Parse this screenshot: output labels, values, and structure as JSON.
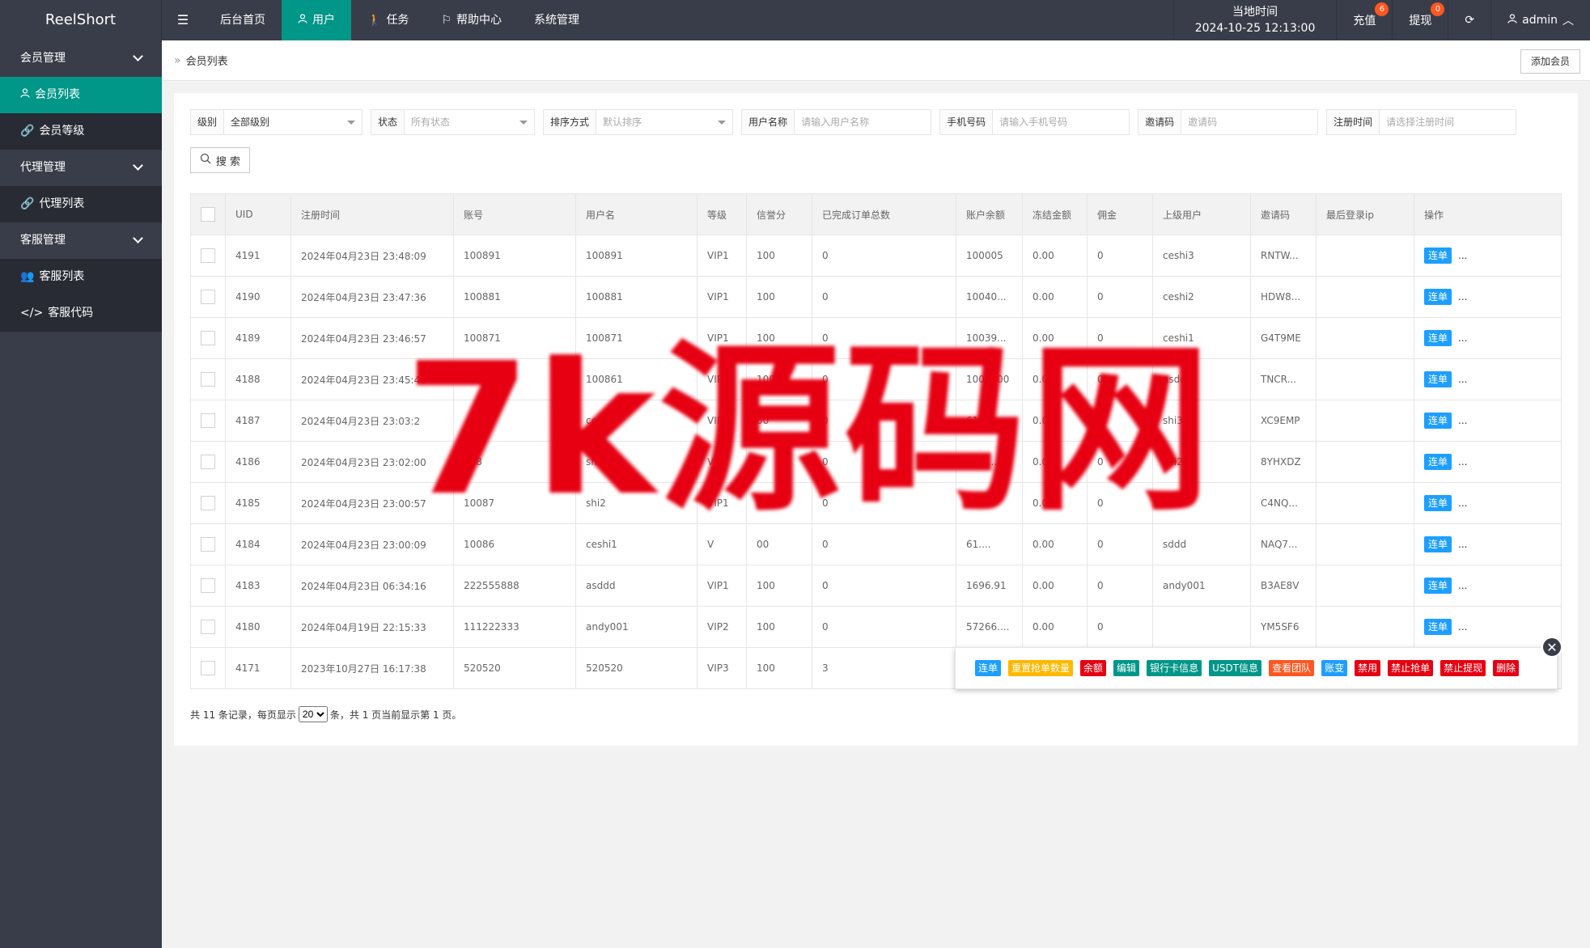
{
  "app": {
    "logo": "ReelShort"
  },
  "topnav": [
    {
      "label": "后台首页",
      "icon": ""
    },
    {
      "label": "用户",
      "icon": "user-icon",
      "active": true
    },
    {
      "label": "任务",
      "icon": "walk-icon"
    },
    {
      "label": "帮助中心",
      "icon": "flag-icon"
    },
    {
      "label": "系统管理",
      "icon": ""
    }
  ],
  "header": {
    "time_label": "当地时间",
    "time_value": "2024-10-25 12:13:00",
    "recharge_label": "充值",
    "recharge_badge": "6",
    "withdraw_label": "提现",
    "withdraw_badge": "0",
    "user": "admin"
  },
  "sidebar": {
    "g1": "会员管理",
    "g1_items": [
      "会员列表",
      "会员等级"
    ],
    "g2": "代理管理",
    "g2_items": [
      "代理列表"
    ],
    "g3": "客服管理",
    "g3_items": [
      "客服列表",
      "客服代码"
    ]
  },
  "breadcrumb": {
    "sep": "»",
    "current": "会员列表"
  },
  "add_button": "添加会员",
  "filters": [
    {
      "label": "级别",
      "value": "全部级别",
      "select": true,
      "dark": true
    },
    {
      "label": "状态",
      "value": "所有状态",
      "select": true
    },
    {
      "label": "排序方式",
      "value": "默认排序",
      "select": true
    },
    {
      "label": "用户名称",
      "value": "请输入用户名称"
    },
    {
      "label": "手机号码",
      "value": "请输入手机号码"
    },
    {
      "label": "邀请码",
      "value": "邀请码"
    },
    {
      "label": "注册时间",
      "value": "请选择注册时间"
    }
  ],
  "search_label": "搜 索",
  "table": {
    "headers": [
      "UID",
      "注册时间",
      "账号",
      "用户名",
      "等级",
      "信誉分",
      "已完成订单总数",
      "账户余额",
      "冻结金额",
      "佣金",
      "上级用户",
      "邀请码",
      "最后登录ip",
      "操作"
    ],
    "rows": [
      [
        "4191",
        "2024年04月23日 23:48:09",
        "100891",
        "100891",
        "VIP1",
        "100",
        "0",
        "100005",
        "0.00",
        "0",
        "ceshi3",
        "RNTW...",
        ""
      ],
      [
        "4190",
        "2024年04月23日 23:47:36",
        "100881",
        "100881",
        "VIP1",
        "100",
        "0",
        "10040...",
        "0.00",
        "0",
        "ceshi2",
        "HDW8...",
        ""
      ],
      [
        "4189",
        "2024年04月23日 23:46:57",
        "100871",
        "100871",
        "VIP1",
        "100",
        "0",
        "10039...",
        "0.00",
        "0",
        "ceshi1",
        "G4T9ME",
        ""
      ],
      [
        "4188",
        "2024年04月23日 23:45:46",
        "100861",
        "100861",
        "VIP2",
        "100",
        "0",
        "1000000",
        "0.00",
        "0",
        "asddd",
        "TNCR...",
        ""
      ],
      [
        "4187",
        "2024年04月23日 23:03:2",
        "",
        "ceshi4",
        "VIP1",
        "00",
        "0",
        "616....",
        "0.00",
        "0",
        "shi3",
        "XC9EMP",
        ""
      ],
      [
        "4186",
        "2024年04月23日 23:02:00",
        "088",
        "shi3",
        "VI",
        "",
        "0",
        "571....",
        "0.00",
        "0",
        "shi2",
        "8YHXDZ",
        ""
      ],
      [
        "4185",
        "2024年04月23日 23:00:57",
        "10087",
        "shi2",
        "VIP1",
        "00",
        "0",
        "34....",
        "0.00",
        "0",
        "shi1",
        "C4NQ...",
        ""
      ],
      [
        "4184",
        "2024年04月23日 23:00:09",
        "10086",
        "ceshi1",
        "V",
        "00",
        "0",
        "61....",
        "0.00",
        "0",
        "sddd",
        "NAQ7...",
        ""
      ],
      [
        "4183",
        "2024年04月23日 06:34:16",
        "222555888",
        "asddd",
        "VIP1",
        "100",
        "0",
        "1696.91",
        "0.00",
        "0",
        "andy001",
        "B3AE8V",
        ""
      ],
      [
        "4180",
        "2024年04月19日 22:15:33",
        "111222333",
        "andy001",
        "VIP2",
        "100",
        "0",
        "57266....",
        "0.00",
        "0",
        "",
        "YM5SF6",
        ""
      ],
      [
        "4171",
        "2023年10月27日 16:17:38",
        "520520",
        "520520",
        "VIP3",
        "100",
        "3",
        "",
        "",
        "",
        "",
        "",
        ""
      ]
    ],
    "action_label": "连单",
    "more_label": "..."
  },
  "pager": {
    "prefix": "共 11 条记录，每页显示",
    "per_page": "20",
    "suffix": "条，共 1 页当前显示第 1 页。"
  },
  "popup_actions": [
    {
      "label": "连单",
      "color": "#1e9fff"
    },
    {
      "label": "重置抢单数量",
      "color": "#ffb800"
    },
    {
      "label": "余额",
      "color": "#e60012"
    },
    {
      "label": "编辑",
      "color": "#009688"
    },
    {
      "label": "银行卡信息",
      "color": "#009688"
    },
    {
      "label": "USDT信息",
      "color": "#009688"
    },
    {
      "label": "查看团队",
      "color": "#ff5722"
    },
    {
      "label": "账变",
      "color": "#1e9fff"
    },
    {
      "label": "禁用",
      "color": "#e60012"
    },
    {
      "label": "禁止抢单",
      "color": "#e60012"
    },
    {
      "label": "禁止提现",
      "color": "#e60012"
    },
    {
      "label": "删除",
      "color": "#e60012"
    }
  ],
  "watermark": "7k源码网"
}
